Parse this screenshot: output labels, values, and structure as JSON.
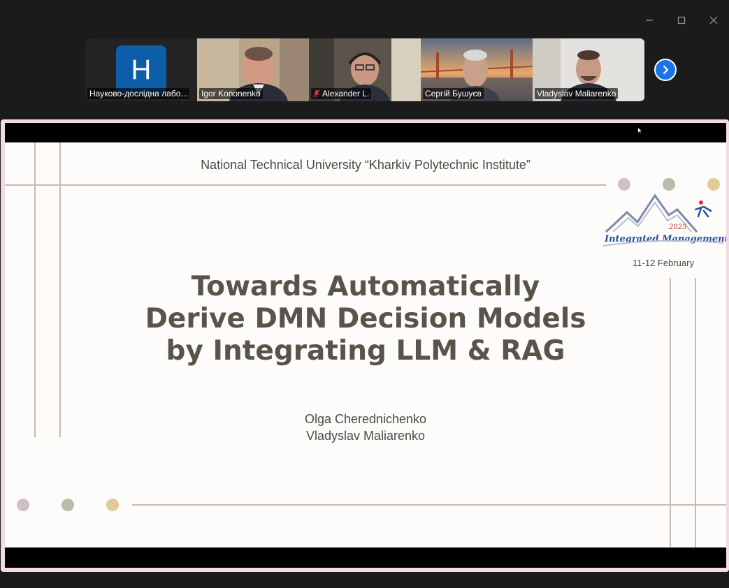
{
  "window": {
    "controls": [
      "minimize",
      "maximize",
      "close"
    ]
  },
  "participants": [
    {
      "name": "Науково-дослідна лабо...",
      "type": "avatar",
      "initial": "H",
      "muted": false,
      "active": false
    },
    {
      "name": "Igor Kononenko",
      "type": "video",
      "muted": false,
      "active": false
    },
    {
      "name": "Alexander L.",
      "type": "video",
      "muted": true,
      "active": false
    },
    {
      "name": "Сергій Бушуєв",
      "type": "video",
      "muted": false,
      "active": false
    },
    {
      "name": "Vladyslav Maliarenko",
      "type": "video",
      "muted": false,
      "active": true
    }
  ],
  "next_page_icon": "chevron-right-icon",
  "slide": {
    "institution": "National Technical University “Kharkiv Polytechnic Institute”",
    "title_lines": [
      "Towards Automatically",
      "Derive DMN Decision Models",
      "by Integrating LLM & RAG"
    ],
    "authors": [
      "Olga Cherednichenko",
      "Vladyslav Maliarenko"
    ],
    "conference": {
      "logo_year": "2025",
      "logo_text": "Integrated Management",
      "dates": "11-12 February"
    }
  },
  "colors": {
    "accent_active": "#2ad06a",
    "next_button": "#1a73e8",
    "title_text": "#585449",
    "deco_line": "#c7bcb2",
    "dot_pink": "#cfc0c6",
    "dot_green": "#b9bca9",
    "dot_gold": "#e0cc99",
    "share_border": "#f2dbe3"
  }
}
